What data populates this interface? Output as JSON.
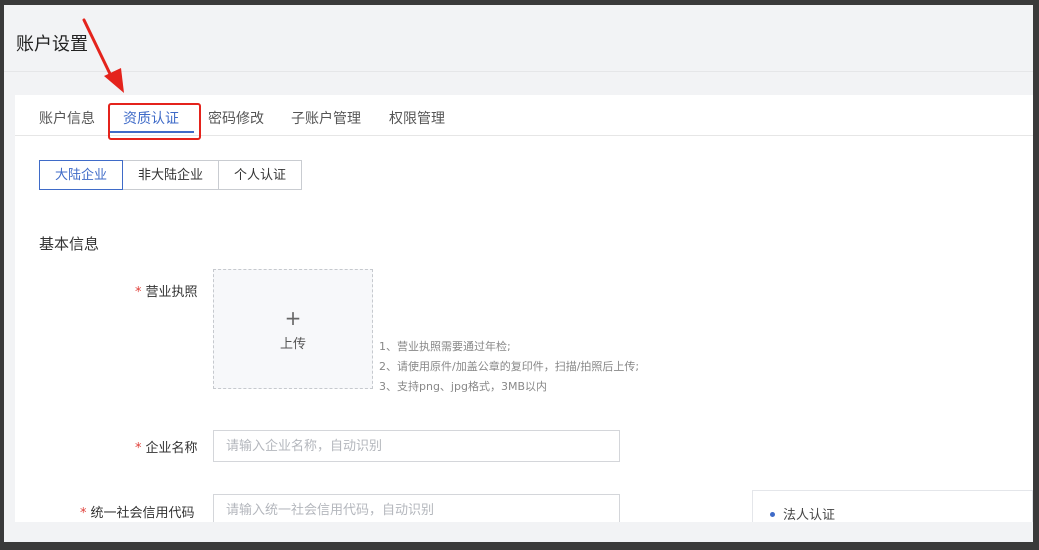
{
  "header": {
    "title": "账户设置"
  },
  "tabs": [
    {
      "label": "账户信息"
    },
    {
      "label": "资质认证"
    },
    {
      "label": "密码修改"
    },
    {
      "label": "子账户管理"
    },
    {
      "label": "权限管理"
    }
  ],
  "active_tab": "资质认证",
  "segments": [
    {
      "label": "大陆企业"
    },
    {
      "label": "非大陆企业"
    },
    {
      "label": "个人认证"
    }
  ],
  "active_segment": "大陆企业",
  "section": {
    "title": "基本信息"
  },
  "form": {
    "license": {
      "required_mark": "*",
      "label": "营业执照",
      "upload_icon": "+",
      "upload_text": "上传",
      "hints": [
        "1、营业执照需要通过年检;",
        "2、请使用原件/加盖公章的复印件，扫描/拍照后上传;",
        "3、支持png、jpg格式，3MB以内"
      ]
    },
    "company_name": {
      "required_mark": "*",
      "label": "企业名称",
      "value": "",
      "placeholder": "请输入企业名称，自动识别"
    },
    "credit_code": {
      "required_mark": "*",
      "label": "统一社会信用代码",
      "value": "",
      "placeholder": "请输入统一社会信用代码，自动识别"
    }
  },
  "floating_panel": {
    "label": "法人认证"
  },
  "annotation": {
    "color": "#e4231c",
    "accent": "#3f6bc8"
  }
}
